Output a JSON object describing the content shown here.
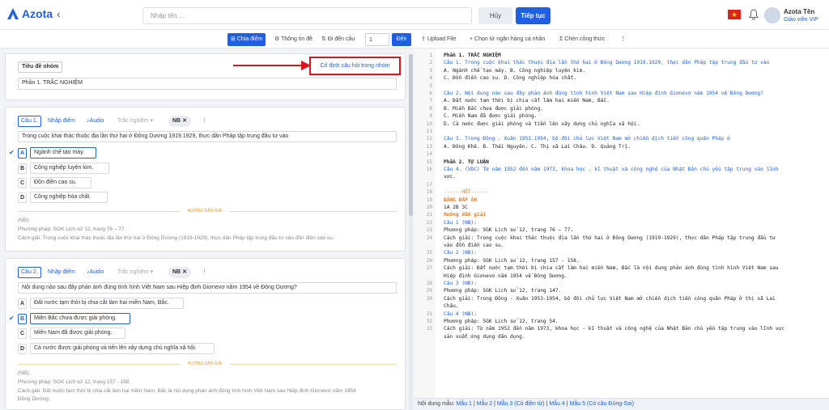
{
  "app": {
    "logo": "Azota",
    "back_icon": "chevron-left-icon"
  },
  "header": {
    "name_placeholder": "Nhập tên ...",
    "cancel_label": "Hủy",
    "next_label": "Tiếp tục",
    "user_name": "Azota Tên",
    "user_role": "Giáo viên VIP"
  },
  "toolbar": {
    "split_score": "Chia điểm",
    "info": "Thông tin đề",
    "goto_label": "Đi đến câu",
    "goto_value": "1",
    "go_label": "Đến",
    "upload": "Upload File",
    "choose_bank": "Chọn từ ngân hàng cá nhân",
    "formula": "Chèn công thức",
    "more": "⋮"
  },
  "group": {
    "title_label": "Tiêu đề nhóm",
    "fix_label": "Cố định câu hỏi trong nhóm",
    "title_value": "Phần 1. TRẮC NGHIỆM"
  },
  "q1": {
    "label": "Câu 1.",
    "score": "Nhập điểm",
    "audio": "Audio",
    "type": "Trắc nghiệm",
    "level": "NB",
    "text": "Trong cuộc khai thác thuộc địa lần thứ hai ở Đông Dương 1919.1929, thực dân Pháp tập trung đầu tư vào",
    "options": [
      {
        "key": "A",
        "text": "Ngành chế tạo máy."
      },
      {
        "key": "B",
        "text": "Công nghiệp luyện kim."
      },
      {
        "key": "C",
        "text": "Đồn điền cao su."
      },
      {
        "key": "D",
        "text": "Công nghiệp hóa chất."
      }
    ],
    "guide": "HƯỚNG DẪN GIẢI",
    "note1": "(NB):",
    "note2": "Phương pháp: SGK Lịch sử 12, trang 76 – 77.",
    "note3": "Cách giải: Trong cuộc khai thác thuộc địa lần thứ hai ở Đông Dương (1919-1929), thực dân Pháp tập trung đầu tư vào đồn điền cao su."
  },
  "q2": {
    "label": "Câu 2.",
    "score": "Nhập điểm",
    "audio": "Audio",
    "type": "Trắc nghiệm",
    "level": "NB",
    "text": "Nội dung nào sau đây phản ánh đúng tình hình Việt Nam sau Hiệp định Giơnevơ năm 1954 về Đông Dương?",
    "options": [
      {
        "key": "A",
        "text": "Đất nước tạm thời bị chia cắt làm hai miền Nam, Bắc."
      },
      {
        "key": "B",
        "text": "Miền Bắc chưa được giải phóng."
      },
      {
        "key": "C",
        "text": "Miền Nam đã được giải phóng."
      },
      {
        "key": "D",
        "text": "Cả nước được giải phóng và tiến lên xây dựng chủ nghĩa xã hội."
      }
    ],
    "guide": "HƯỚNG DẪN GIẢI",
    "note1": "(NB):",
    "note2": "Phương pháp: SGK Lịch sử 12, trang 157 - 158.",
    "note3": "Cách giải: Đất nước tạm thời bị chia cắt làm hai miền Nam, Bắc là nội dung phản ánh đúng tình hình Việt Nam sau Hiệp định Giơnevơ năm 1954",
    "note4": "Đông Dương."
  },
  "editor": {
    "lines": [
      {
        "n": "1",
        "t": "Phần 1. TRẮC NGHIỆM",
        "c": "#222",
        "b": true
      },
      {
        "n": "2",
        "t": "Câu 1. Trong cuộc khai thác thuộc địa lần thứ hai ở Đông Dương 1919.1929, thực dân Pháp tập trung đầu tư vào",
        "c": "#222"
      },
      {
        "n": "3",
        "t": "A. Ngành chế tạo máy.      B. Công nghiệp luyện kim.",
        "c": "#222"
      },
      {
        "n": "4",
        "t": "C. Đồn điền cao su.        D. Công nghiệp hóa chất.",
        "c": "#222"
      },
      {
        "n": "5",
        "t": "",
        "c": "#222"
      },
      {
        "n": "6",
        "t": "Câu 2. Nội dung nào sau đây phản ánh đúng tình hình Việt Nam sau Hiệp định Giơnevơ năm 1954 về Đông Dương?",
        "c": "#222"
      },
      {
        "n": "7",
        "t": "A. Đất nước tạm thời bị chia cắt làm hai miền Nam, Bắc.",
        "c": "#222"
      },
      {
        "n": "8",
        "t": "B. Miền Bắc chưa được giải phóng.",
        "c": "#222"
      },
      {
        "n": "9",
        "t": "C. Miền Nam đã được giải phóng.",
        "c": "#222"
      },
      {
        "n": "10",
        "t": "D. Cả nước được giải phóng và tiến lên xây dựng chủ nghĩa xã hội.",
        "c": "#222"
      },
      {
        "n": "11",
        "t": "",
        "c": "#222"
      },
      {
        "n": "12",
        "t": "Câu 3. Trong Đông . Xuân 1953.1954, bộ đội chủ lực Việt Nam mở chiến dịch tiến công quân Pháp ở",
        "c": "#222"
      },
      {
        "n": "13",
        "t": "A. Đông Khê.     B. Thái Nguyên.      C. Thị xã Lai Châu.      D. Quảng Trị.",
        "c": "#222"
      },
      {
        "n": "14",
        "t": "",
        "c": "#222"
      },
      {
        "n": "15",
        "t": "Phần 2. TỰ LUẬN",
        "c": "#222",
        "b": true
      },
      {
        "n": "16",
        "t": "Câu 4. (VDC) Từ năm 1952 đến năm 1973, khoa học . kĩ thuật và công nghệ của Nhật Bản chủ yếu tập trung vào lĩnh",
        "c": "#222"
      },
      {
        "n": "",
        "t": "vực.",
        "c": "#222"
      },
      {
        "n": "17",
        "t": "",
        "c": "#222"
      },
      {
        "n": "18",
        "t": "------HẾT------",
        "c": "#e07a2a"
      },
      {
        "n": "19",
        "t": "BẢNG ĐÁP ÁN",
        "c": "#e07a2a",
        "b": true
      },
      {
        "n": "20",
        "t": "1A 2B 3C",
        "c": "#222"
      },
      {
        "n": "21",
        "t": "Hướng dẫn giải",
        "c": "#e07a2a",
        "b": true
      },
      {
        "n": "22",
        "t": "Câu 1 (NB):",
        "c": "#222"
      },
      {
        "n": "23",
        "t": "Phương pháp: SGK Lịch sử 12, trang 76 – 77.",
        "c": "#222"
      },
      {
        "n": "24",
        "t": "Cách giải: Trong cuộc khai thác thuộc địa lần thứ hai ở Đông Dương (1919-1929), thực dân Pháp tập trung đầu tư",
        "c": "#222"
      },
      {
        "n": "",
        "t": "vào đồn điền cao su.",
        "c": "#222"
      },
      {
        "n": "25",
        "t": "Câu 2 (NB):",
        "c": "#222"
      },
      {
        "n": "26",
        "t": "Phương pháp: SGK Lịch sử 12, trang 157 - 158.",
        "c": "#222"
      },
      {
        "n": "27",
        "t": "Cách giải: Đất nước tạm thời bị chia cắt làm hai miền Nam, Bắc là nội dung phản ánh đúng tình hình Việt Nam sau",
        "c": "#222"
      },
      {
        "n": "",
        "t": "Hiệp định Giơnevơ năm 1954 về Đông Dương.",
        "c": "#222"
      },
      {
        "n": "28",
        "t": "Câu 3 (NB):",
        "c": "#222"
      },
      {
        "n": "29",
        "t": "Phương pháp: SGK Lịch sử 12, trang 147.",
        "c": "#222"
      },
      {
        "n": "30",
        "t": "Cách giải: Trong Đông - Xuân 1953-1954, bộ đội chủ lực Việt Nam mở chiến dịch tiến công quân Pháp ở thị xã Lai",
        "c": "#222"
      },
      {
        "n": "",
        "t": "Châu.",
        "c": "#222"
      },
      {
        "n": "31",
        "t": "Câu 4 (NB):",
        "c": "#222"
      },
      {
        "n": "32",
        "t": "Phương pháp: SGK Lịch sử 12, trang 54.",
        "c": "#222"
      },
      {
        "n": "33",
        "t": "Cách giải: Từ năm 1952 đến năm 1973, khoa học - kĩ thuật và công nghệ của Nhật Bản chủ yếu tập trung vào lĩnh vực",
        "c": "#222"
      },
      {
        "n": "",
        "t": "sản xuất ứng dụng dân dụng.",
        "c": "#222"
      }
    ]
  },
  "footer": {
    "label": "Nội dung mẫu:",
    "m1": "Mẫu 1",
    "m2": "Mẫu 2",
    "m3": "Mẫu 3 (Có điền từ)",
    "m4": "Mẫu 4",
    "m5": "Mẫu 5 (Có câu Đúng-Sai)",
    "sep": " | "
  },
  "colors": {
    "accent": "#1e5fe6",
    "highlight": "#e0101a",
    "guide": "#e59a3a"
  }
}
